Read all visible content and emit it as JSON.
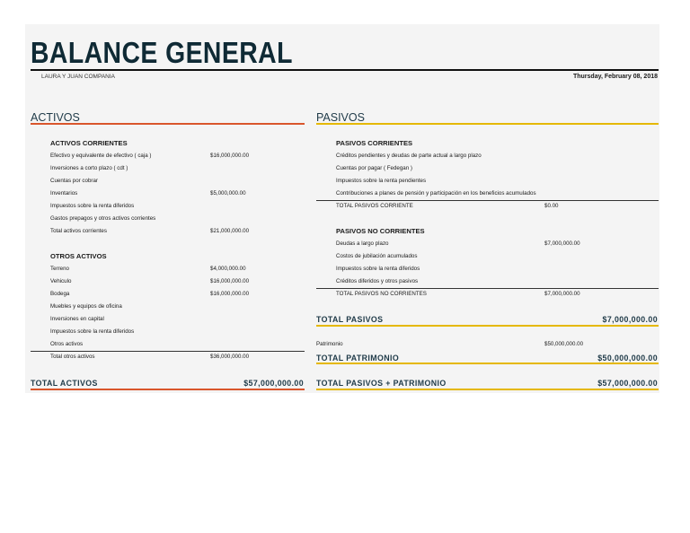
{
  "title": "BALANCE GENERAL",
  "company": "LAURA Y JUAN COMPANIA",
  "date": "Thursday, February 08, 2018",
  "colors": {
    "activos_accent": "#d9562c",
    "pasivos_accent": "#e5b800"
  },
  "activos": {
    "heading": "ACTIVOS",
    "corrientes": {
      "heading": "ACTIVOS CORRIENTES",
      "rows": [
        {
          "label": "Efectivo y equivalente de efectivo ( caja )",
          "value": "$16,000,000.00"
        },
        {
          "label": "Inversiones a corto plazo ( cdt )",
          "value": ""
        },
        {
          "label": "Cuentas por cobrar",
          "value": ""
        },
        {
          "label": "Inventarios",
          "value": "$5,000,000.00"
        },
        {
          "label": "Impuestos sobre la renta diferidos",
          "value": ""
        },
        {
          "label": "Gastos prepagos y otros activos corrientes",
          "value": ""
        },
        {
          "label": "Total activos corrientes",
          "value": "$21,000,000.00"
        }
      ]
    },
    "otros": {
      "heading": "OTROS ACTIVOS",
      "rows": [
        {
          "label": "Terreno",
          "value": "$4,000,000.00"
        },
        {
          "label": "Vehiculo",
          "value": "$16,000,000.00"
        },
        {
          "label": "Bodega",
          "value": "$16,000,000.00"
        },
        {
          "label": "Muebles y equipos de oficina",
          "value": ""
        },
        {
          "label": "Inversiones en capital",
          "value": ""
        },
        {
          "label": "Impuestos sobre la renta diferidos",
          "value": ""
        },
        {
          "label": "Otros activos",
          "value": ""
        }
      ],
      "total": {
        "label": "Total otros activos",
        "value": "$36,000,000.00"
      }
    },
    "total": {
      "label": "TOTAL ACTIVOS",
      "value": "$57,000,000.00"
    }
  },
  "pasivos": {
    "heading": "PASIVOS",
    "corrientes": {
      "heading": "PASIVOS CORRIENTES",
      "rows": [
        {
          "label": "Créditos pendientes y deudas de parte actual a largo plazo",
          "value": ""
        },
        {
          "label": "Cuentas por pagar ( Fedegan )",
          "value": ""
        },
        {
          "label": "Impuestos sobre la renta pendientes",
          "value": ""
        },
        {
          "label": "Contribuciones a planes de pensión y participación en los beneficios acumulados",
          "value": ""
        }
      ],
      "total": {
        "label": "TOTAL PASIVOS CORRIENTE",
        "value": "$0.00"
      }
    },
    "no_corrientes": {
      "heading": "PASIVOS NO CORRIENTES",
      "rows": [
        {
          "label": "Deudas a largo plazo",
          "value": "$7,000,000.00"
        },
        {
          "label": "Costos de jubilación acumulados",
          "value": ""
        },
        {
          "label": "Impuestos sobre la renta diferidos",
          "value": ""
        },
        {
          "label": "Créditos diferidos y otros pasivos",
          "value": ""
        }
      ],
      "total": {
        "label": "TOTAL PASIVOS NO CORRIENTES",
        "value": "$7,000,000.00"
      }
    },
    "total": {
      "label": "TOTAL PASIVOS",
      "value": "$7,000,000.00"
    },
    "patrimonio": {
      "label": "Patrimonio",
      "value": "$50,000,000.00"
    },
    "total_patrimonio": {
      "label": "TOTAL PATRIMONIO",
      "value": "$50,000,000.00"
    },
    "total_pasivos_patrimonio": {
      "label": "TOTAL PASIVOS + PATRIMONIO",
      "value": "$57,000,000.00"
    }
  }
}
